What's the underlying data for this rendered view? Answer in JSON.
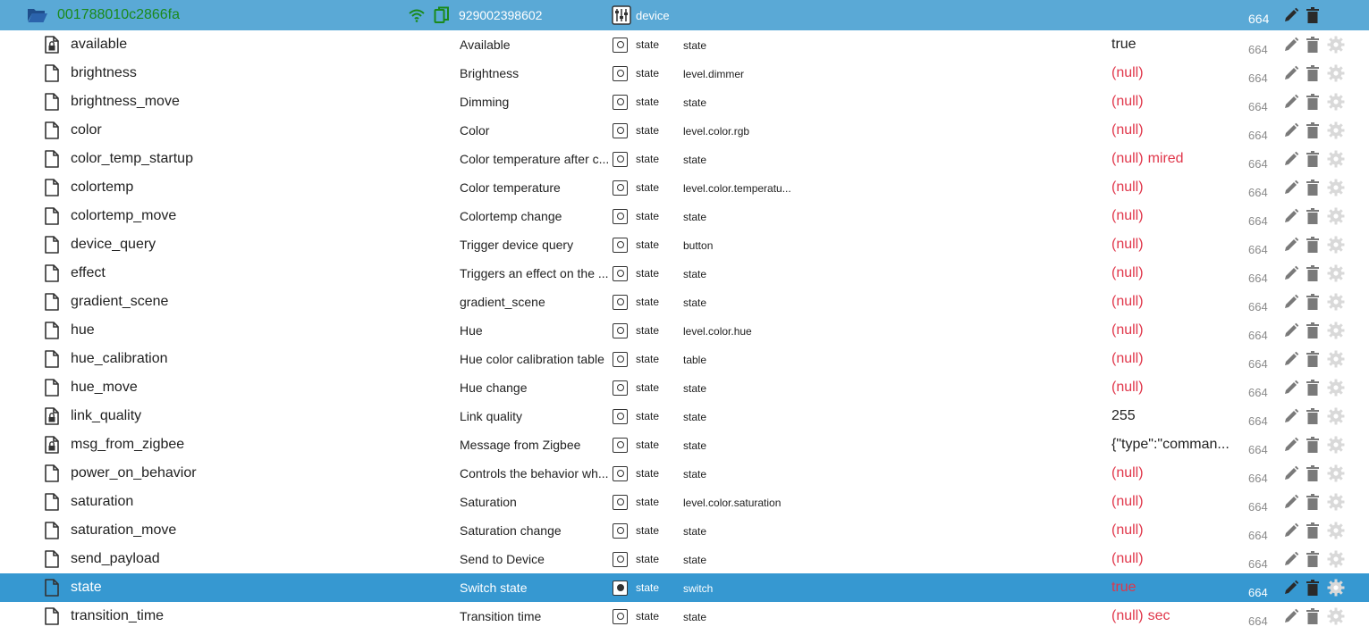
{
  "colors": {
    "header_bg": "#5aa9d6",
    "selected_bg": "#3698d1",
    "device_id": "#1a8a1a",
    "null_value": "#e0364a",
    "count": "#8a8a8a"
  },
  "device": {
    "id": "001788010c2866fa",
    "serial": "929002398602",
    "type_label": "device",
    "count": "664",
    "icons": [
      "folder-open-icon",
      "wifi-icon",
      "copy-icon",
      "device-icon",
      "pencil-icon",
      "trash-icon"
    ]
  },
  "states": [
    {
      "id": "available",
      "name": "Available",
      "type": "state",
      "role": "state",
      "value": "true",
      "unit": "",
      "is_null": false,
      "count": "664",
      "icon": "file-lock-icon",
      "selected": false
    },
    {
      "id": "brightness",
      "name": "Brightness",
      "type": "state",
      "role": "level.dimmer",
      "value": "(null)",
      "unit": "",
      "is_null": true,
      "count": "664",
      "icon": "file-icon",
      "selected": false
    },
    {
      "id": "brightness_move",
      "name": "Dimming",
      "type": "state",
      "role": "state",
      "value": "(null)",
      "unit": "",
      "is_null": true,
      "count": "664",
      "icon": "file-icon",
      "selected": false
    },
    {
      "id": "color",
      "name": "Color",
      "type": "state",
      "role": "level.color.rgb",
      "value": "(null)",
      "unit": "",
      "is_null": true,
      "count": "664",
      "icon": "file-icon",
      "selected": false
    },
    {
      "id": "color_temp_startup",
      "name": "Color temperature after c...",
      "type": "state",
      "role": "state",
      "value": "(null)",
      "unit": "mired",
      "is_null": true,
      "count": "664",
      "icon": "file-icon",
      "selected": false
    },
    {
      "id": "colortemp",
      "name": "Color temperature",
      "type": "state",
      "role": "level.color.temperatu...",
      "value": "(null)",
      "unit": "",
      "is_null": true,
      "count": "664",
      "icon": "file-icon",
      "selected": false
    },
    {
      "id": "colortemp_move",
      "name": "Colortemp change",
      "type": "state",
      "role": "state",
      "value": "(null)",
      "unit": "",
      "is_null": true,
      "count": "664",
      "icon": "file-icon",
      "selected": false
    },
    {
      "id": "device_query",
      "name": "Trigger device query",
      "type": "state",
      "role": "button",
      "value": "(null)",
      "unit": "",
      "is_null": true,
      "count": "664",
      "icon": "file-icon",
      "selected": false
    },
    {
      "id": "effect",
      "name": "Triggers an effect on the ...",
      "type": "state",
      "role": "state",
      "value": "(null)",
      "unit": "",
      "is_null": true,
      "count": "664",
      "icon": "file-icon",
      "selected": false
    },
    {
      "id": "gradient_scene",
      "name": "gradient_scene",
      "type": "state",
      "role": "state",
      "value": "(null)",
      "unit": "",
      "is_null": true,
      "count": "664",
      "icon": "file-icon",
      "selected": false
    },
    {
      "id": "hue",
      "name": "Hue",
      "type": "state",
      "role": "level.color.hue",
      "value": "(null)",
      "unit": "",
      "is_null": true,
      "count": "664",
      "icon": "file-icon",
      "selected": false
    },
    {
      "id": "hue_calibration",
      "name": "Hue color calibration table",
      "type": "state",
      "role": "table",
      "value": "(null)",
      "unit": "",
      "is_null": true,
      "count": "664",
      "icon": "file-icon",
      "selected": false
    },
    {
      "id": "hue_move",
      "name": "Hue change",
      "type": "state",
      "role": "state",
      "value": "(null)",
      "unit": "",
      "is_null": true,
      "count": "664",
      "icon": "file-icon",
      "selected": false
    },
    {
      "id": "link_quality",
      "name": "Link quality",
      "type": "state",
      "role": "state",
      "value": "255",
      "unit": "",
      "is_null": false,
      "count": "664",
      "icon": "file-lock-icon",
      "selected": false
    },
    {
      "id": "msg_from_zigbee",
      "name": "Message from Zigbee",
      "type": "state",
      "role": "state",
      "value": "{\"type\":\"comman...",
      "unit": "",
      "is_null": false,
      "count": "664",
      "icon": "file-lock-icon",
      "selected": false
    },
    {
      "id": "power_on_behavior",
      "name": "Controls the behavior wh...",
      "type": "state",
      "role": "state",
      "value": "(null)",
      "unit": "",
      "is_null": true,
      "count": "664",
      "icon": "file-icon",
      "selected": false
    },
    {
      "id": "saturation",
      "name": "Saturation",
      "type": "state",
      "role": "level.color.saturation",
      "value": "(null)",
      "unit": "",
      "is_null": true,
      "count": "664",
      "icon": "file-icon",
      "selected": false
    },
    {
      "id": "saturation_move",
      "name": "Saturation change",
      "type": "state",
      "role": "state",
      "value": "(null)",
      "unit": "",
      "is_null": true,
      "count": "664",
      "icon": "file-icon",
      "selected": false
    },
    {
      "id": "send_payload",
      "name": "Send to Device",
      "type": "state",
      "role": "state",
      "value": "(null)",
      "unit": "",
      "is_null": true,
      "count": "664",
      "icon": "file-icon",
      "selected": false
    },
    {
      "id": "state",
      "name": "Switch state",
      "type": "state",
      "role": "switch",
      "value": "true",
      "unit": "",
      "is_null": false,
      "count": "664",
      "icon": "file-icon",
      "selected": true
    },
    {
      "id": "transition_time",
      "name": "Transition time",
      "type": "state",
      "role": "state",
      "value": "(null)",
      "unit": "sec",
      "is_null": true,
      "count": "664",
      "icon": "file-icon",
      "selected": false
    }
  ]
}
